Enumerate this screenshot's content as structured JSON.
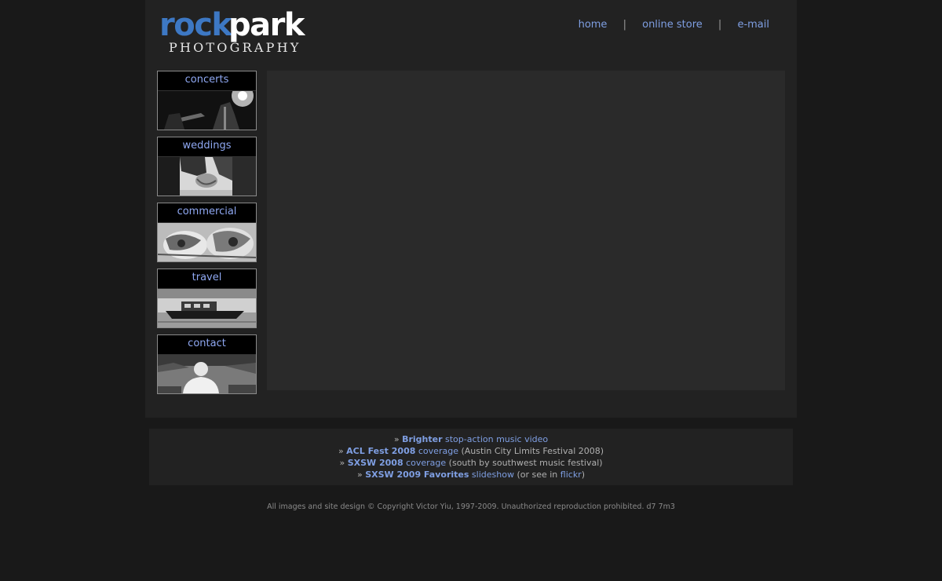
{
  "logo": {
    "word1": "rock",
    "word2": "park",
    "subtitle": "PHOTOGRAPHY"
  },
  "topnav": {
    "items": [
      "home",
      "online store",
      "e-mail"
    ],
    "separator": "|"
  },
  "sidebar": {
    "items": [
      {
        "label": "concerts",
        "image": "concert-guitarist-photo"
      },
      {
        "label": "weddings",
        "image": "wedding-hands-photo"
      },
      {
        "label": "commercial",
        "image": "food-plate-photo"
      },
      {
        "label": "travel",
        "image": "boat-harbor-photo"
      },
      {
        "label": "contact",
        "image": "portrait-photo"
      }
    ]
  },
  "links": [
    {
      "prefix": "» ",
      "bold_link": "Brighter",
      "link": " stop-action music video",
      "suffix": "",
      "link2": "",
      "suffix2": ""
    },
    {
      "prefix": "» ",
      "bold_link": "ACL Fest 2008",
      "link": " coverage",
      "suffix": " (Austin City Limits Festival 2008)",
      "link2": "",
      "suffix2": ""
    },
    {
      "prefix": "» ",
      "bold_link": "SXSW 2008",
      "link": " coverage",
      "suffix": " (south by southwest music festival)",
      "link2": "",
      "suffix2": ""
    },
    {
      "prefix": "» ",
      "bold_link": "SXSW 2009 Favorites",
      "link": " slideshow",
      "suffix": " (or see in ",
      "link2": "flickr",
      "suffix2": ")"
    }
  ],
  "copyright": "All images and site design © Copyright Victor Yiu, 1997-2009. Unauthorized reproduction prohibited. d7 7m3",
  "colors": {
    "background": "#191919",
    "panel": "#222222",
    "link": "#7f9fe3",
    "logo_blue": "#3d78c4"
  }
}
